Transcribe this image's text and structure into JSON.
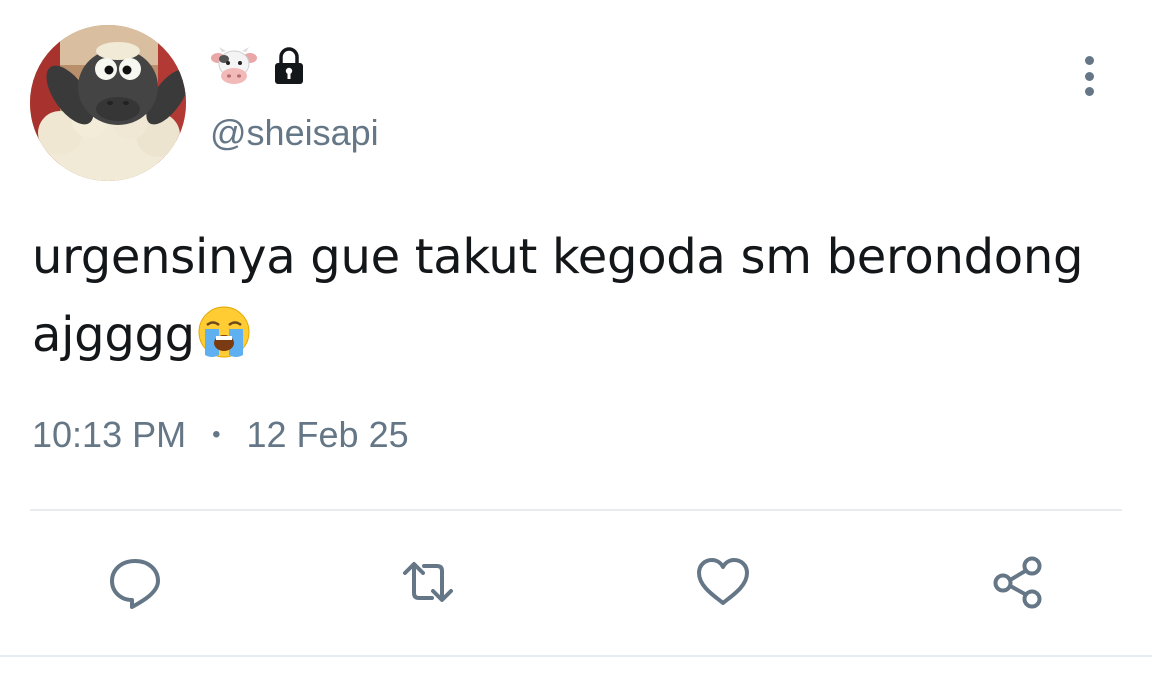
{
  "tweet": {
    "display_name_icons": [
      "cow-face-icon",
      "lock-icon"
    ],
    "handle": "@sheisapi",
    "text_line_1": "urgensinya gue takut kegoda sm berondong",
    "text_line_2": "ajgggg",
    "text_emoji": "loudly-crying-face-icon",
    "time": "10:13 PM",
    "separator": "•",
    "date": "12 Feb 25"
  },
  "actions": [
    "reply-icon",
    "retweet-icon",
    "like-icon",
    "share-icon"
  ],
  "colors": {
    "text": "#14171a",
    "secondary": "#657786",
    "divider": "#e6ecf0",
    "background": "#ffffff"
  }
}
